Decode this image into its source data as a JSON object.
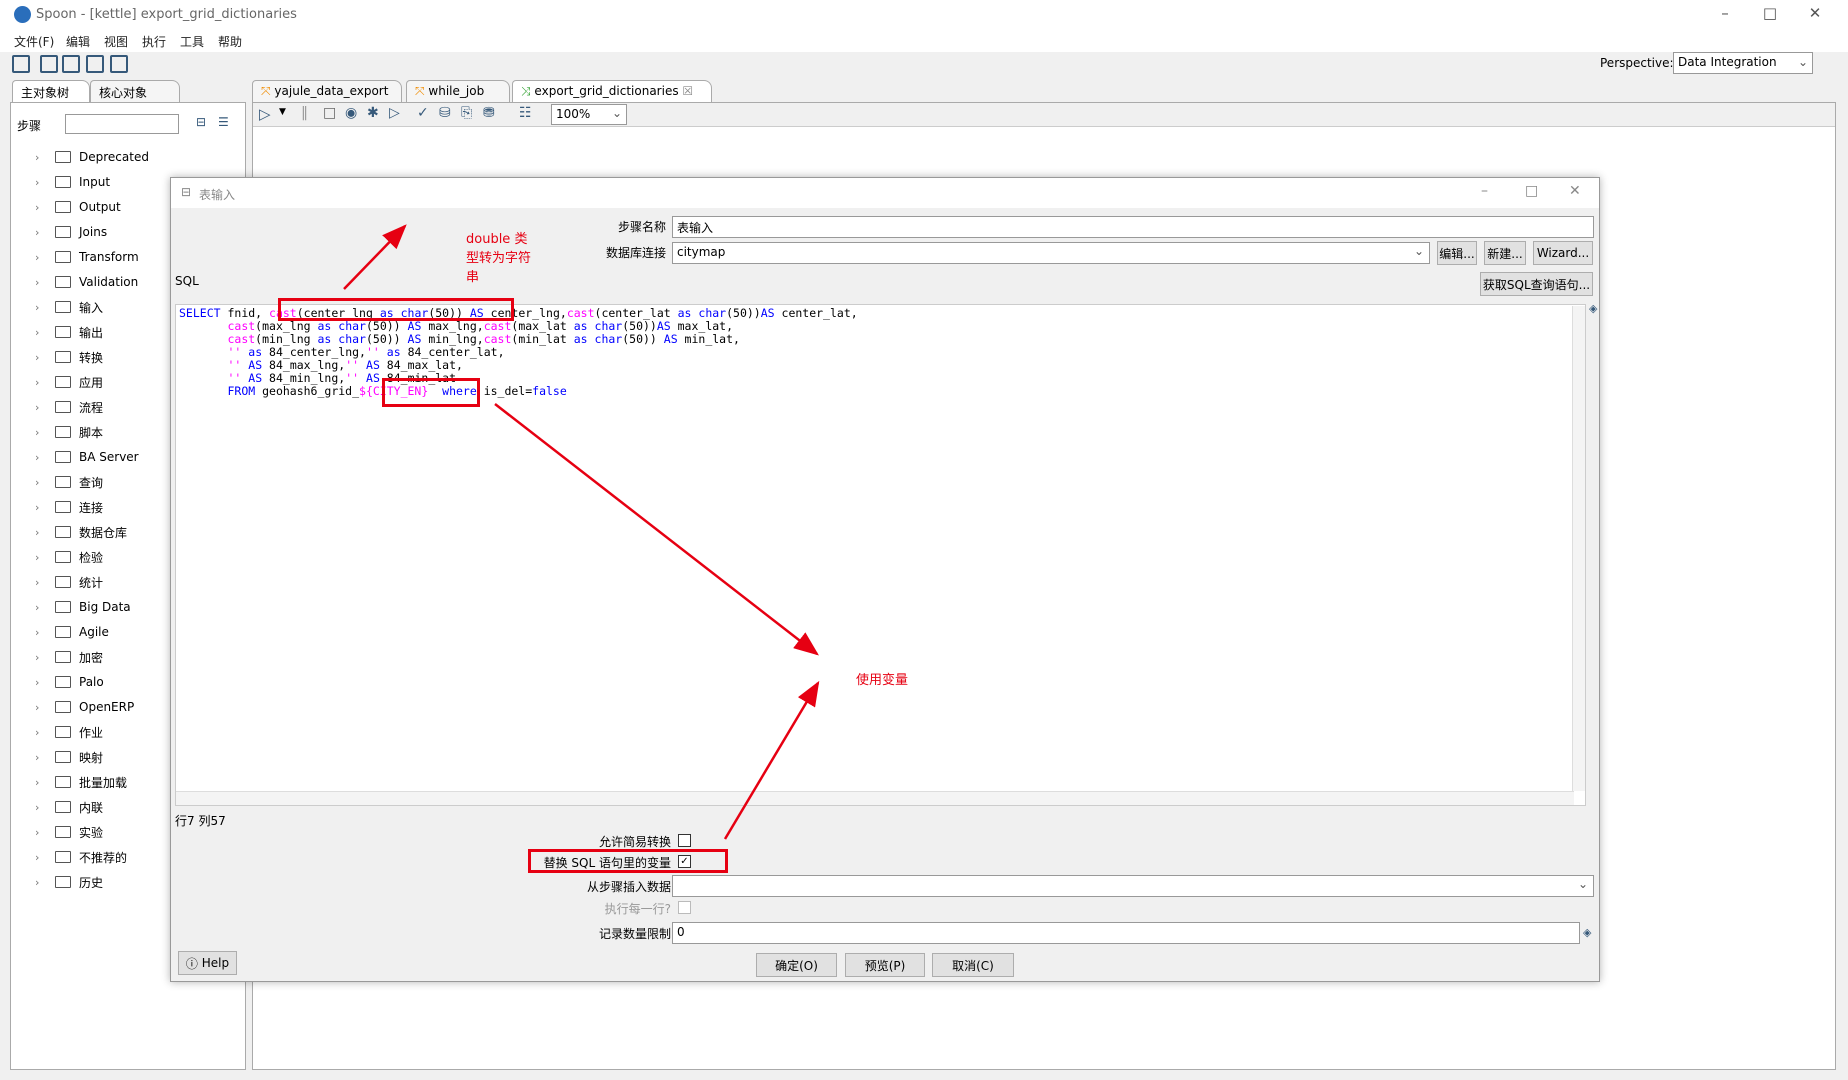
{
  "window": {
    "title": "Spoon - [kettle] export_grid_dictionaries"
  },
  "menu": [
    "文件(F)",
    "编辑",
    "视图",
    "执行",
    "工具",
    "帮助"
  ],
  "perspective": {
    "label": "Perspective:",
    "value": "Data Integration"
  },
  "left_panel": {
    "tabs": [
      "主对象树",
      "核心对象"
    ],
    "search_label": "步骤",
    "search_value": "",
    "items": [
      "Deprecated",
      "Input",
      "Output",
      "Joins",
      "Transform",
      "Validation",
      "输入",
      "输出",
      "转换",
      "应用",
      "流程",
      "脚本",
      "BA Server",
      "查询",
      "连接",
      "数据仓库",
      "检验",
      "统计",
      "Big Data",
      "Agile",
      "加密",
      "Palo",
      "OpenERP",
      "作业",
      "映射",
      "批量加载",
      "内联",
      "实验",
      "不推荐的",
      "历史"
    ]
  },
  "editor_tabs": [
    {
      "label": "yajule_data_export",
      "active": false
    },
    {
      "label": "while_job",
      "active": false
    },
    {
      "label": "export_grid_dictionaries",
      "active": true
    }
  ],
  "zoom": "100%",
  "dialog": {
    "title": "表输入",
    "step_name_label": "步骤名称",
    "step_name": "表输入",
    "db_label": "数据库连接",
    "db_value": "citymap",
    "edit_btn": "编辑...",
    "new_btn": "新建...",
    "wizard_btn": "Wizard...",
    "get_sql_btn": "获取SQL查询语句...",
    "sql_label": "SQL",
    "position": "行7 列57",
    "lazy_label": "允许简易转换",
    "lazy_checked": false,
    "replace_label": "替换 SQL 语句里的变量",
    "replace_checked": true,
    "insert_label": "从步骤插入数据",
    "insert_value": "",
    "each_row_label": "执行每一行?",
    "each_row_checked": false,
    "limit_label": "记录数量限制",
    "limit_value": "0",
    "ok": "确定(O)",
    "preview": "预览(P)",
    "cancel": "取消(C)",
    "help": "Help"
  },
  "sql_lines": [
    [
      [
        "kw",
        "SELECT"
      ],
      [
        "t",
        " fnid, "
      ],
      [
        "fn",
        "cast"
      ],
      [
        "t",
        "(center_lng "
      ],
      [
        "kw",
        "as"
      ],
      [
        "t",
        " "
      ],
      [
        "kw",
        "char"
      ],
      [
        "t",
        "(50)) "
      ],
      [
        "kw",
        "AS"
      ],
      [
        "t",
        " center_lng,"
      ],
      [
        "fn",
        "cast"
      ],
      [
        "t",
        "(center_lat "
      ],
      [
        "kw",
        "as"
      ],
      [
        "t",
        " "
      ],
      [
        "kw",
        "char"
      ],
      [
        "t",
        "(50))"
      ],
      [
        "kw",
        "AS"
      ],
      [
        "t",
        " center_lat,"
      ]
    ],
    [
      [
        "t",
        "       "
      ],
      [
        "fn",
        "cast"
      ],
      [
        "t",
        "(max_lng "
      ],
      [
        "kw",
        "as"
      ],
      [
        "t",
        " "
      ],
      [
        "kw",
        "char"
      ],
      [
        "t",
        "(50)) "
      ],
      [
        "kw",
        "AS"
      ],
      [
        "t",
        " max_lng,"
      ],
      [
        "fn",
        "cast"
      ],
      [
        "t",
        "(max_lat "
      ],
      [
        "kw",
        "as"
      ],
      [
        "t",
        " "
      ],
      [
        "kw",
        "char"
      ],
      [
        "t",
        "(50))"
      ],
      [
        "kw",
        "AS"
      ],
      [
        "t",
        " max_lat,"
      ]
    ],
    [
      [
        "t",
        "       "
      ],
      [
        "fn",
        "cast"
      ],
      [
        "t",
        "(min_lng "
      ],
      [
        "kw",
        "as"
      ],
      [
        "t",
        " "
      ],
      [
        "kw",
        "char"
      ],
      [
        "t",
        "(50)) "
      ],
      [
        "kw",
        "AS"
      ],
      [
        "t",
        " min_lng,"
      ],
      [
        "fn",
        "cast"
      ],
      [
        "t",
        "(min_lat "
      ],
      [
        "kw",
        "as"
      ],
      [
        "t",
        " "
      ],
      [
        "kw",
        "char"
      ],
      [
        "t",
        "(50)) "
      ],
      [
        "kw",
        "AS"
      ],
      [
        "t",
        " min_lat,"
      ]
    ],
    [
      [
        "t",
        "       "
      ],
      [
        "fn",
        "''"
      ],
      [
        "t",
        " "
      ],
      [
        "kw",
        "as"
      ],
      [
        "t",
        " 84_center_lng,"
      ],
      [
        "fn",
        "''"
      ],
      [
        "t",
        " "
      ],
      [
        "kw",
        "as"
      ],
      [
        "t",
        " 84_center_lat,"
      ]
    ],
    [
      [
        "t",
        "       "
      ],
      [
        "fn",
        "''"
      ],
      [
        "t",
        " "
      ],
      [
        "kw",
        "AS"
      ],
      [
        "t",
        " 84_max_lng,"
      ],
      [
        "fn",
        "''"
      ],
      [
        "t",
        " "
      ],
      [
        "kw",
        "AS"
      ],
      [
        "t",
        " 84_max_lat,"
      ]
    ],
    [
      [
        "t",
        "       "
      ],
      [
        "fn",
        "''"
      ],
      [
        "t",
        " "
      ],
      [
        "kw",
        "AS"
      ],
      [
        "t",
        " 84_min_lng,"
      ],
      [
        "fn",
        "''"
      ],
      [
        "t",
        " "
      ],
      [
        "kw",
        "AS"
      ],
      [
        "t",
        " 84_min_lat"
      ]
    ],
    [
      [
        "t",
        "       "
      ],
      [
        "kw",
        "FROM"
      ],
      [
        "t",
        " geohash6_grid_"
      ],
      [
        "fn",
        "${CITY_EN}"
      ],
      [
        "t",
        "  "
      ],
      [
        "kw",
        "where"
      ],
      [
        "t",
        " is_del="
      ],
      [
        "kw",
        "false"
      ]
    ]
  ],
  "annotations": {
    "cast_note": "double 类型转为字符串",
    "var_note": "使用变量",
    "color": "#e60012"
  }
}
